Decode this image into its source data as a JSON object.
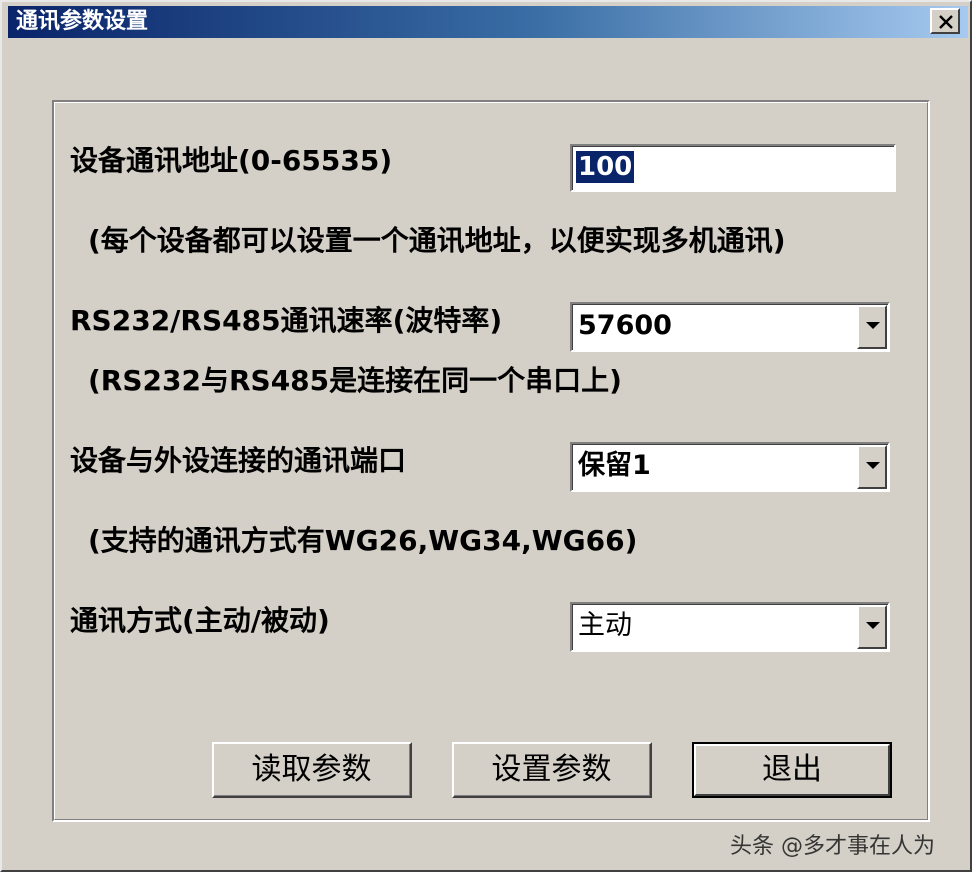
{
  "window": {
    "title": "通讯参数设置",
    "close_symbol": "×"
  },
  "form": {
    "address": {
      "label": "设备通讯地址(0-65535)",
      "value": "100",
      "note": "(每个设备都可以设置一个通讯地址，以便实现多机通讯)"
    },
    "baud": {
      "label": "RS232/RS485通讯速率(波特率)",
      "value": "57600",
      "note": "(RS232与RS485是连接在同一个串口上)"
    },
    "port": {
      "label": "设备与外设连接的通讯端口",
      "value": "保留1",
      "note": "(支持的通讯方式有WG26,WG34,WG66)"
    },
    "mode": {
      "label": "通讯方式(主动/被动)",
      "value": "主动"
    }
  },
  "buttons": {
    "read": "读取参数",
    "set": "设置参数",
    "exit": "退出"
  },
  "watermark": "头条 @多才事在人为",
  "icons": {
    "close": "close-icon",
    "dropdown": "chevron-down-icon"
  },
  "colors": {
    "titlebar_start": "#0a246a",
    "titlebar_end": "#a6caf0",
    "face": "#d4d0c8",
    "selection": "#0a246a"
  }
}
